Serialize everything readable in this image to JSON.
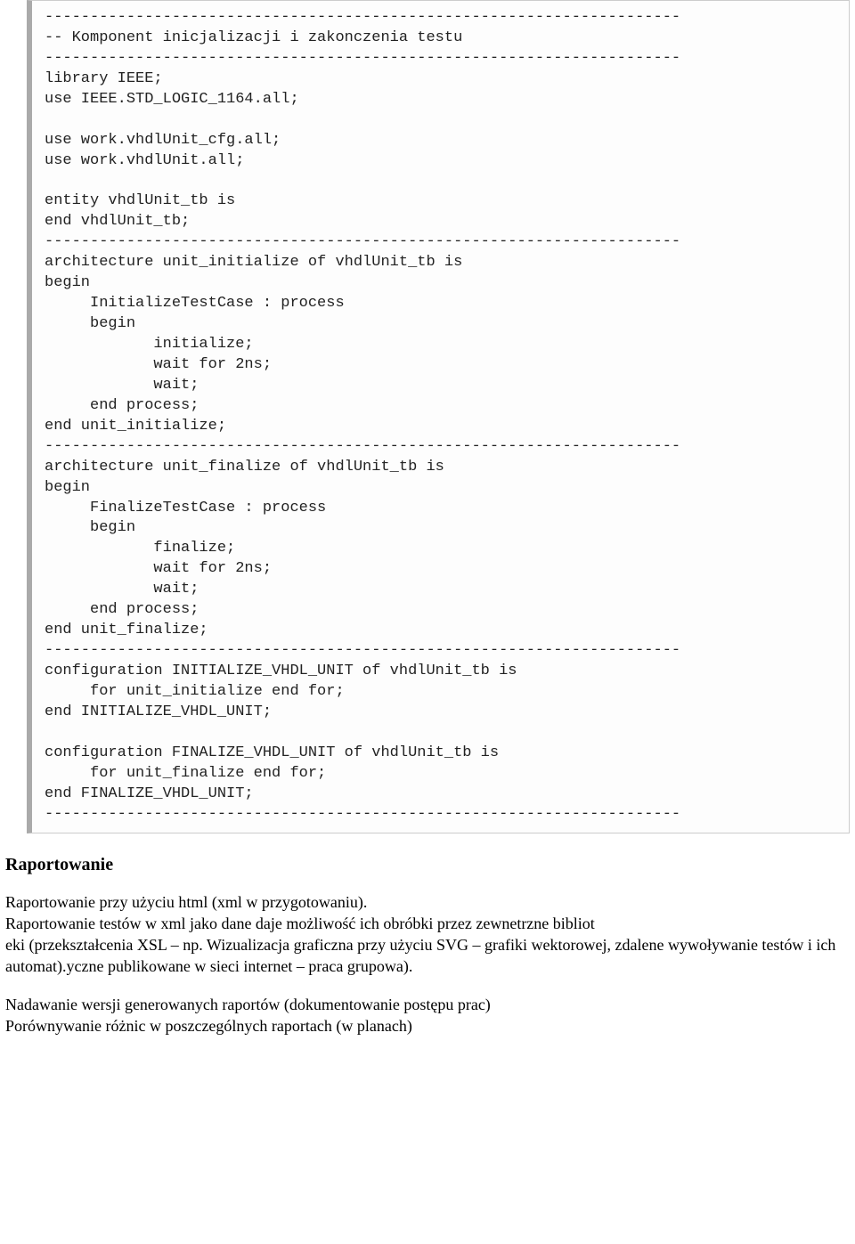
{
  "code_block": {
    "text": "----------------------------------------------------------------------\n-- Komponent inicjalizacji i zakonczenia testu\n----------------------------------------------------------------------\nlibrary IEEE;\nuse IEEE.STD_LOGIC_1164.all;\n\nuse work.vhdlUnit_cfg.all;\nuse work.vhdlUnit.all;\n\nentity vhdlUnit_tb is\nend vhdlUnit_tb;\n----------------------------------------------------------------------\narchitecture unit_initialize of vhdlUnit_tb is\nbegin\n     InitializeTestCase : process\n     begin\n            initialize;\n            wait for 2ns;\n            wait;\n     end process;\nend unit_initialize;\n----------------------------------------------------------------------\narchitecture unit_finalize of vhdlUnit_tb is\nbegin\n     FinalizeTestCase : process\n     begin\n            finalize;\n            wait for 2ns;\n            wait;\n     end process;\nend unit_finalize;\n----------------------------------------------------------------------\nconfiguration INITIALIZE_VHDL_UNIT of vhdlUnit_tb is\n     for unit_initialize end for;\nend INITIALIZE_VHDL_UNIT;\n\nconfiguration FINALIZE_VHDL_UNIT of vhdlUnit_tb is\n     for unit_finalize end for;\nend FINALIZE_VHDL_UNIT;\n----------------------------------------------------------------------"
  },
  "heading": "Raportowanie",
  "paragraph1": {
    "line1": "Raportowanie przy użyciu html (xml w przygotowaniu).",
    "line2": "Raportowanie testów w xml jako dane daje możliwość ich obróbki przez zewnetrzne bibliot",
    "line3": "eki (przekształcenia XSL – np. Wizualizacja graficzna przy użyciu SVG – grafiki wektorowej, zdalene wywoływanie testów i ich automat).yczne publikowane w sieci internet – praca grupowa)."
  },
  "paragraph2": {
    "line1": "Nadawanie wersji generowanych raportów (dokumentowanie postępu prac)",
    "line2": "Porównywanie różnic w poszczególnych raportach (w planach)"
  }
}
